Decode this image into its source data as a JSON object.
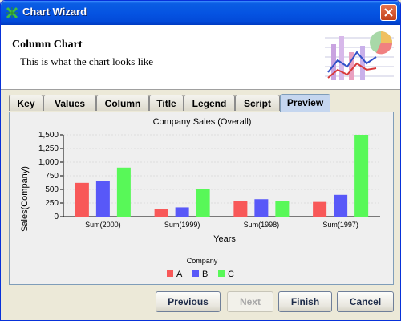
{
  "window": {
    "title": "Chart Wizard",
    "close_icon": "close-icon"
  },
  "header": {
    "title": "Column Chart",
    "subtitle": "This is what the chart looks like"
  },
  "tabs": [
    {
      "label": "Key",
      "active": false
    },
    {
      "label": "Values",
      "active": false
    },
    {
      "label": "Column",
      "active": false
    },
    {
      "label": "Title",
      "active": false
    },
    {
      "label": "Legend",
      "active": false
    },
    {
      "label": "Script",
      "active": false
    },
    {
      "label": "Preview",
      "active": true
    }
  ],
  "buttons": {
    "previous": "Previous",
    "next": "Next",
    "finish": "Finish",
    "cancel": "Cancel"
  },
  "chart_data": {
    "type": "bar",
    "title": "Company Sales (Overall)",
    "xlabel": "Years",
    "ylabel": "Sales(Company)",
    "categories": [
      "Sum(2000)",
      "Sum(1999)",
      "Sum(1998)",
      "Sum(1997)"
    ],
    "series": [
      {
        "name": "A",
        "color": "#f85858",
        "values": [
          620,
          140,
          290,
          270
        ]
      },
      {
        "name": "B",
        "color": "#5858f8",
        "values": [
          650,
          170,
          320,
          400
        ]
      },
      {
        "name": "C",
        "color": "#58f858",
        "values": [
          900,
          500,
          290,
          1500
        ]
      }
    ],
    "ylim": [
      0,
      1500
    ],
    "yticks": [
      "0",
      "250",
      "500",
      "750",
      "1,000",
      "1,250",
      "1,500"
    ],
    "legend_title": "Company",
    "legend_position": "bottom",
    "grid": true
  }
}
